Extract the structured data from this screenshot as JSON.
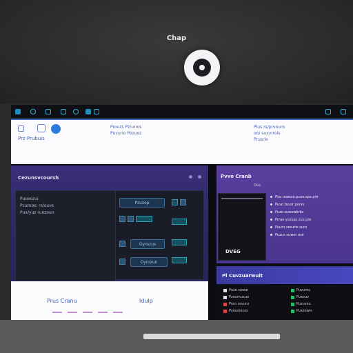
{
  "app": {
    "title": "Chap"
  },
  "taskbar": {
    "items": [
      "",
      "",
      "",
      "",
      ""
    ]
  },
  "white_panel": {
    "title": "Prz Prubuis",
    "col1": [
      "Prouzs Pzrurois",
      "Puvurio Pozuez"
    ],
    "col2": [
      "Plus rs/prvouro",
      "oo/ suxvrrois",
      "Prusrio"
    ]
  },
  "main_panel": {
    "header": "Cezunsvcoursh",
    "left_rows": [
      "Puxeozui",
      "Pcumos: rs/ouvs",
      "Pux/yuz ruozoun"
    ],
    "buttons": [
      "Pzuzop",
      "Oyrozus",
      "Oyrozun"
    ],
    "footer_left": "Prus Cranu",
    "footer_right": "Idulp"
  },
  "right_panel": {
    "title": "Pvvo Cranb",
    "subtitle": "Ouo",
    "video_label": "DVEG",
    "list": [
      "Puo ruwozo puzo spo pre",
      "Puso zuusr porss",
      "Puzo suwewbrbs",
      "Prruo yozuso zux pre",
      "Puum sesurie suro",
      "Puxus suwer oze"
    ]
  },
  "dark_panel": {
    "title": "Pl Cuvzuarwuit",
    "rows_left": [
      "Puzo suwar",
      "Pzoumuxuo",
      "Puro orvuru",
      "Pzousrocos"
    ],
    "rows_right": [
      "Puvurou",
      "Puxouv",
      "Puzuvsu",
      "Puxzowis"
    ]
  },
  "colors": {
    "accent": "#4a6ec6",
    "purple": "#3a2f7a",
    "green": "#28c068",
    "red": "#e04040"
  }
}
